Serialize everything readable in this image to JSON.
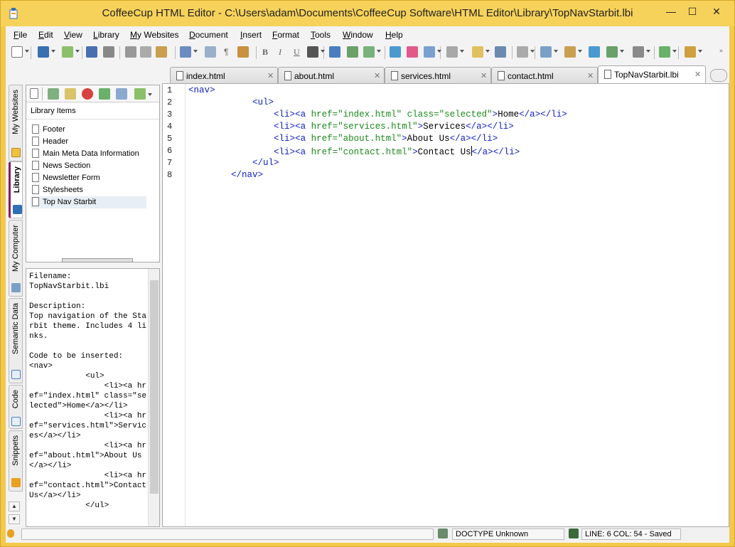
{
  "window": {
    "title": "CoffeeCup HTML Editor - C:\\Users\\adam\\Documents\\CoffeeCup Software\\HTML Editor\\Library\\TopNavStarbit.lbi",
    "minimize_glyph": "—",
    "maximize_glyph": "☐",
    "close_glyph": "✕"
  },
  "menu": [
    {
      "label": "File",
      "u": "F",
      "rest": "ile"
    },
    {
      "label": "Edit",
      "u": "E",
      "rest": "dit"
    },
    {
      "label": "View",
      "u": "V",
      "rest": "iew"
    },
    {
      "label": "Library",
      "u": "L",
      "rest": "ibrary"
    },
    {
      "label": "My Websites",
      "u": "M",
      "rest": "y Websites"
    },
    {
      "label": "Document",
      "u": "D",
      "rest": "ocument"
    },
    {
      "label": "Insert",
      "u": "I",
      "rest": "nsert"
    },
    {
      "label": "Format",
      "u": "F",
      "rest": "ormat"
    },
    {
      "label": "Tools",
      "u": "T",
      "rest": "ools"
    },
    {
      "label": "Window",
      "u": "W",
      "rest": "indow"
    },
    {
      "label": "Help",
      "u": "H",
      "rest": "elp"
    }
  ],
  "toolbar": {
    "bold": "B",
    "italic": "I",
    "underline": "U",
    "paragraph": "¶",
    "icons": [
      "new-document-icon",
      "save-icon",
      "open-icon",
      "undo-icon",
      "redo-icon",
      "cut-icon",
      "copy-icon",
      "paste-icon",
      "font-icon",
      "find-icon",
      "paragraph-icon",
      "insert-icon",
      "bold-icon",
      "italic-icon",
      "underline-icon",
      "align-icon",
      "list-icon",
      "image-icon",
      "web-icon",
      "link-icon",
      "color-icon",
      "table-icon",
      "form-icon",
      "edit-icon",
      "clipboard-icon",
      "settings-icon",
      "layout-icon",
      "preview-icon",
      "upload-icon",
      "globe-icon",
      "browser-icon",
      "spellcheck-icon",
      "zoom-icon"
    ]
  },
  "tabs": [
    {
      "label": "index.html",
      "close": "✕"
    },
    {
      "label": "about.html",
      "close": "✕"
    },
    {
      "label": "services.html",
      "close": "✕"
    },
    {
      "label": "contact.html",
      "close": "✕"
    },
    {
      "label": "TopNavStarbit.lbi",
      "close": "✕"
    }
  ],
  "side_tabs": [
    "My Websites",
    "Library",
    "My Computer",
    "Semantic Data",
    "Code",
    "Snippets"
  ],
  "library": {
    "header": "Library Items",
    "items": [
      "Footer",
      "Header",
      "Main Meta Data Information",
      "News Section",
      "Newsletter Form",
      "Stylesheets",
      "Top Nav Starbit"
    ],
    "selected": "Top Nav Starbit"
  },
  "description": {
    "text": "Filename:\nTopNavStarbit.lbi\n\nDescription:\nTop navigation of the Starbit theme. Includes 4 links.\n\nCode to be inserted:\n<nav>\n            <ul>\n                <li><a href=\"index.html\" class=\"selected\">Home</a></li>\n                <li><a href=\"services.html\">Services</a></li>\n                <li><a href=\"about.html\">About Us</a></li>\n                <li><a href=\"contact.html\">Contact Us</a></li>\n            </ul>"
  },
  "editor": {
    "line_numbers": [
      "1",
      "2",
      "3",
      "4",
      "5",
      "6",
      "7",
      "8"
    ],
    "lines": [
      "<nav>",
      "            <ul>",
      "                <li><a href=\"index.html\" class=\"selected\">Home</a></li>",
      "                <li><a href=\"services.html\">Services</a></li>",
      "                <li><a href=\"about.html\">About Us</a></li>",
      "                <li><a href=\"contact.html\">Contact Us</a></li>",
      "            </ul>",
      "        </nav>"
    ]
  },
  "status": {
    "doctype": "DOCTYPE Unknown",
    "position": "LINE: 6  COL: 54 - Saved"
  }
}
